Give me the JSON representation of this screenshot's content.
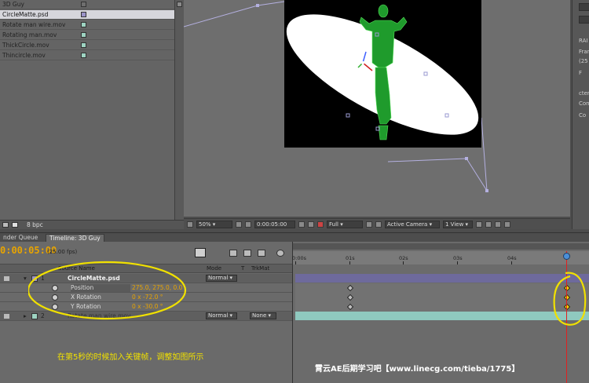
{
  "project": {
    "items": [
      {
        "name": "3D Guy",
        "swatch": "#6e6e6e"
      },
      {
        "name": "CircleMatte.psd",
        "swatch": "#9b93c8",
        "selected": true
      },
      {
        "name": "Rotate man wire.mov",
        "swatch": "#9ed4c2"
      },
      {
        "name": "Rotating man.mov",
        "swatch": "#9ed4c2"
      },
      {
        "name": "ThickCircle.mov",
        "swatch": "#9ed4c2"
      },
      {
        "name": "Thincircle.mov",
        "swatch": "#9ed4c2"
      }
    ],
    "bit_depth": "8 bpc"
  },
  "viewer": {
    "zoom": "50%",
    "timecode": "0:00:05:00",
    "resolution": "Full",
    "camera": "Active Camera",
    "view_layout": "1 View"
  },
  "right_panel": {
    "labels": [
      "RAI",
      "Fran",
      "(25",
      "F",
      "cter",
      "Cont",
      "Co"
    ]
  },
  "tabs": {
    "render_queue": "nder Queue",
    "timeline": "Timeline: 3D Guy"
  },
  "timeline": {
    "current_time": "0:00:05:00",
    "fps": "(25.00 fps)",
    "headers": {
      "source_name": "Source Name",
      "mode": "Mode",
      "t": "T",
      "trkmat": "TrkMat"
    },
    "ruler": [
      "0:00s",
      "01s",
      "02s",
      "03s",
      "04s"
    ],
    "layers": [
      {
        "index": "1",
        "name": "CircleMatte.psd",
        "mode": "Normal",
        "color": "#9b93c8"
      },
      {
        "index": "2",
        "name": "Rotate man wire.mov",
        "mode": "Normal",
        "trkmat": "None",
        "color": "#9ed4c2"
      }
    ],
    "properties": [
      {
        "name": "Position",
        "value": "275.0, 275.0, 0.0"
      },
      {
        "name": "X Rotation",
        "value": "0 x -72.0 °"
      },
      {
        "name": "Y Rotation",
        "value": "0 x -30.0 °"
      }
    ]
  },
  "annotation": "在第5秒的时候加入关键帧，调整如图所示",
  "watermark": "霄云AE后期学习吧【www.linecg.com/tieba/1775】",
  "colors": {
    "accent_timecode": "#e8a400",
    "annotation_yellow": "#f0e000",
    "layer1_bar": "#6e6a9c",
    "layer2_bar": "#8fc9bf",
    "playhead": "#e02020"
  }
}
